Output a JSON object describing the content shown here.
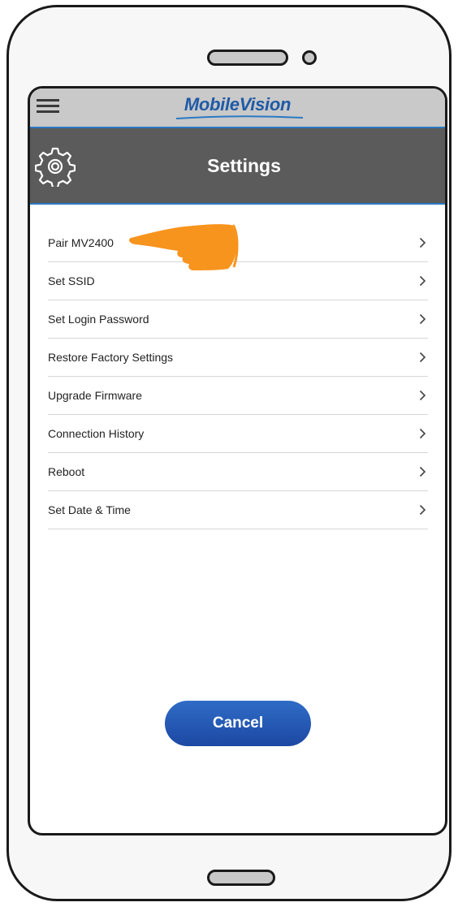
{
  "app": {
    "brand": "MobileVision",
    "brand_color": "#1f5aa6",
    "accent_color": "#2a79c4"
  },
  "header": {
    "title": "Settings",
    "icon": "gear-icon"
  },
  "menu": {
    "icon": "hamburger-menu-icon"
  },
  "settings_items": [
    {
      "label": "Pair MV2400",
      "icon": "chevron-right-icon"
    },
    {
      "label": "Set SSID",
      "icon": "chevron-right-icon"
    },
    {
      "label": "Set Login Password",
      "icon": "chevron-right-icon"
    },
    {
      "label": "Restore Factory Settings",
      "icon": "chevron-right-icon"
    },
    {
      "label": "Upgrade Firmware",
      "icon": "chevron-right-icon"
    },
    {
      "label": "Connection History",
      "icon": "chevron-right-icon"
    },
    {
      "label": "Reboot",
      "icon": "chevron-right-icon"
    },
    {
      "label": "Set Date & Time",
      "icon": "chevron-right-icon"
    }
  ],
  "annotation": {
    "icon": "pointing-hand-icon",
    "color": "#f7941d"
  },
  "footer": {
    "cancel_label": "Cancel"
  }
}
